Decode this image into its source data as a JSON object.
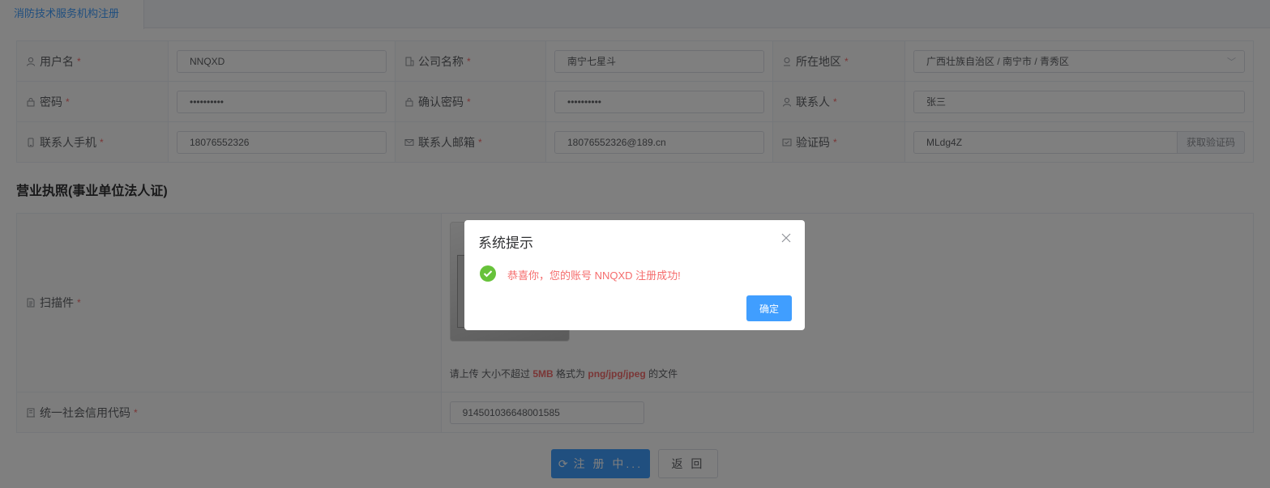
{
  "tab": {
    "label": "消防技术服务机构注册"
  },
  "form": {
    "username_label": "用户名",
    "username_value": "NNQXD",
    "company_label": "公司名称",
    "company_value": "南宁七星斗",
    "region_label": "所在地区",
    "region_value": "广西壮族自治区 / 南宁市 / 青秀区",
    "password_label": "密码",
    "password_value": "••••••••••",
    "confirm_label": "确认密码",
    "confirm_value": "••••••••••",
    "contact_label": "联系人",
    "contact_value": "张三",
    "phone_label": "联系人手机",
    "phone_value": "18076552326",
    "email_label": "联系人邮箱",
    "email_value": "18076552326@189.cn",
    "code_label": "验证码",
    "code_value": "MLdg4Z",
    "code_button": "获取验证码",
    "required_mark": "*"
  },
  "license": {
    "section_title": "营业执照(事业单位法人证)",
    "scan_label": "扫描件",
    "hint_prefix": "请上传 大小不超过",
    "hint_size": "5MB",
    "hint_mid": "格式为",
    "hint_format": "png/jpg/jpeg",
    "hint_suffix": "的文件",
    "credit_label": "统一社会信用代码",
    "credit_value": "914501036648001585"
  },
  "actions": {
    "submit_label": "注 册 中...",
    "back_label": "返 回"
  },
  "dialog": {
    "title": "系统提示",
    "message": "恭喜你，您的账号 NNQXD 注册成功!",
    "ok_label": "确定"
  },
  "icons": {
    "user": "user-icon",
    "company": "building-icon",
    "region": "location-icon",
    "lock": "lock-icon",
    "phone": "mobile-icon",
    "email": "mail-icon",
    "code": "message-icon",
    "document": "document-icon",
    "credit": "office-icon",
    "success": "success-icon",
    "close": "close-icon",
    "loading": "loading-icon"
  },
  "colors": {
    "primary": "#409eff",
    "danger": "#f56c6c",
    "success": "#67c23a"
  }
}
